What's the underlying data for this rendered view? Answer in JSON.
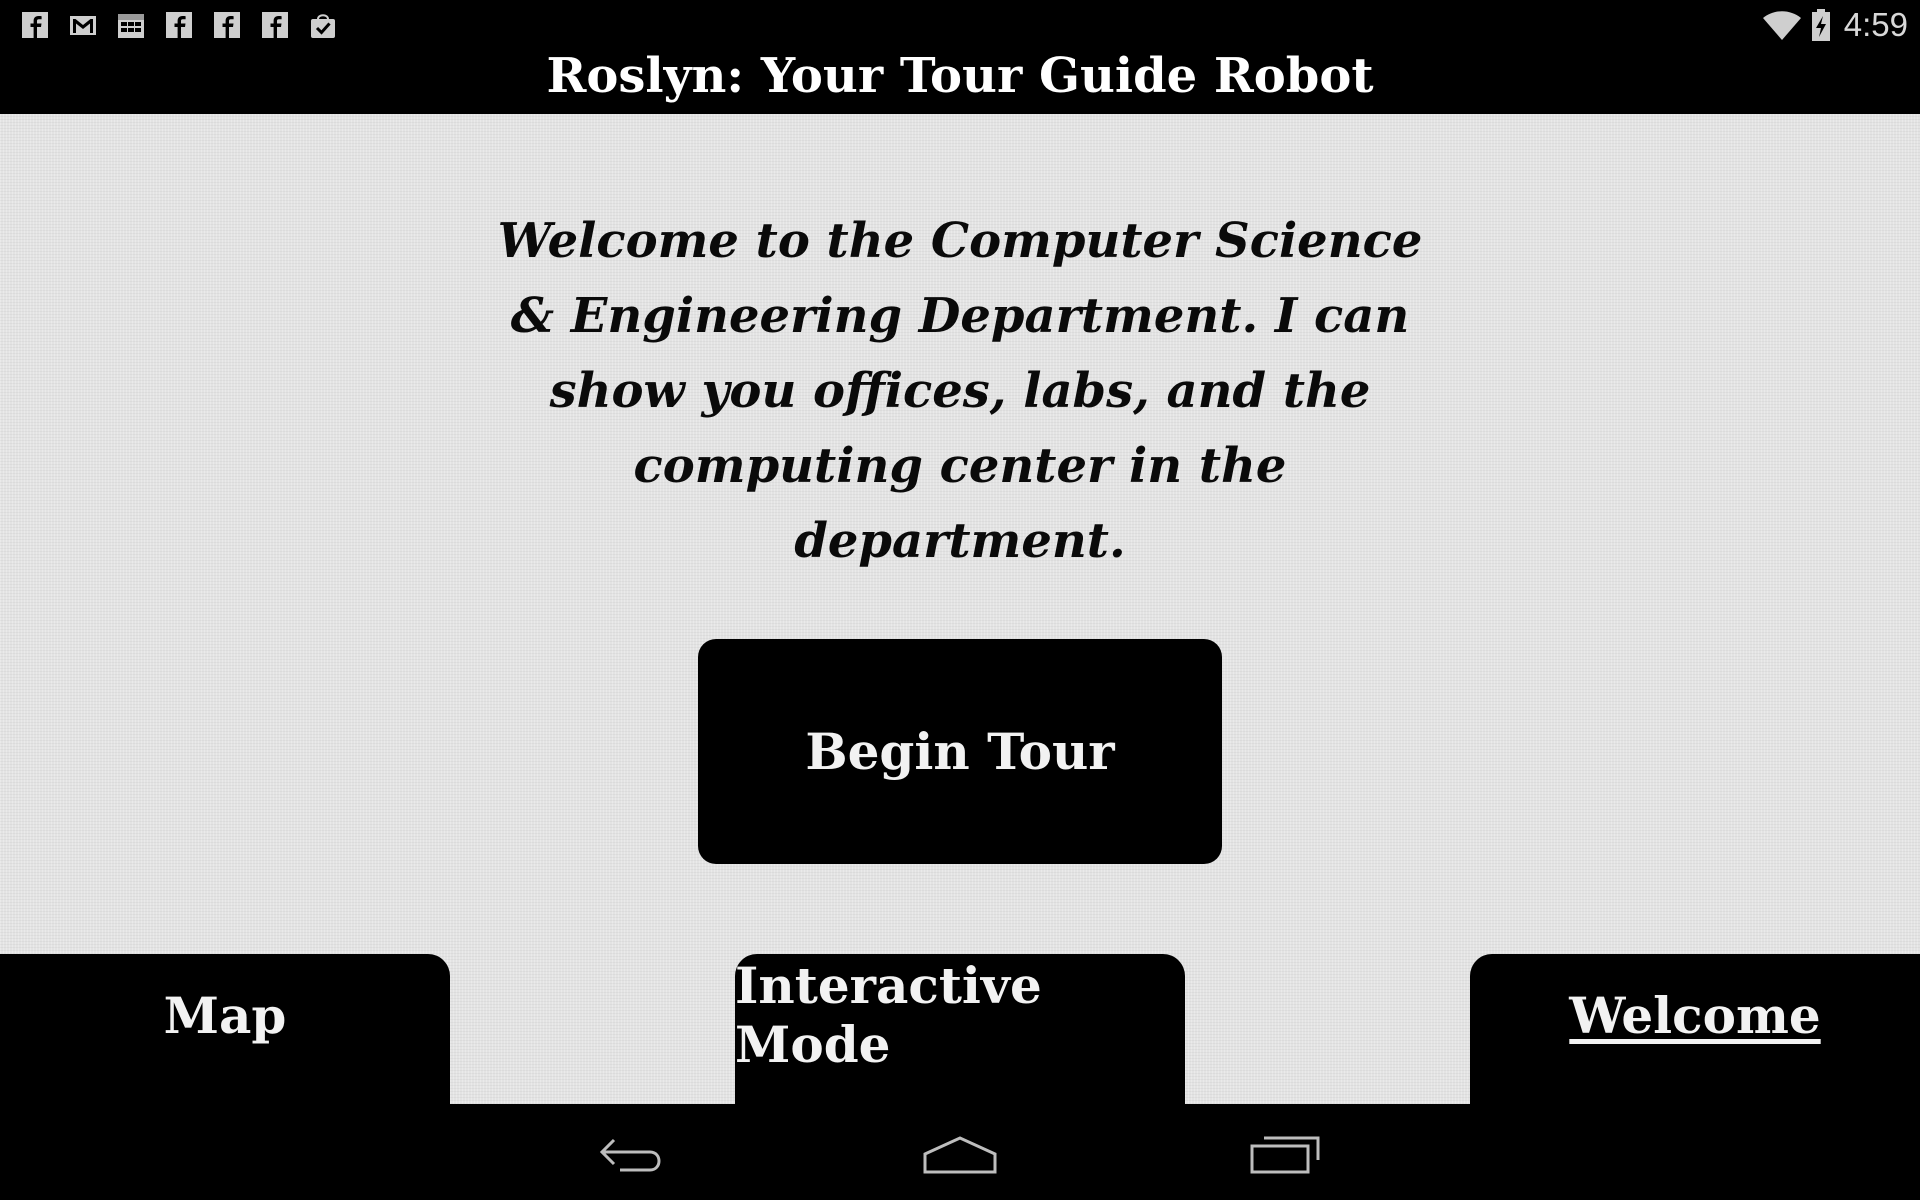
{
  "status_bar": {
    "notifications": [
      "facebook-icon",
      "gmail-icon",
      "calendar-icon",
      "facebook-icon",
      "facebook-icon",
      "facebook-icon",
      "play-store-icon"
    ],
    "clock": "4:59",
    "system_icons": [
      "wifi-icon",
      "battery-charging-icon"
    ]
  },
  "app": {
    "title": "Roslyn: Your Tour Guide Robot"
  },
  "main": {
    "welcome_text": "Welcome to the Computer Science & Engineering Department. I can show you offices, labs, and the computing center in the department.",
    "begin_tour_label": "Begin Tour"
  },
  "tabs": [
    {
      "label": "Map",
      "selected": false
    },
    {
      "label": "Interactive Mode",
      "selected": false
    },
    {
      "label": "Welcome",
      "selected": true
    }
  ],
  "navigation": [
    "back-icon",
    "home-icon",
    "recent-apps-icon"
  ],
  "colors": {
    "bar_background": "#000000",
    "content_background": "#e3e3e3",
    "text_light": "#f2f2f2",
    "text_dark": "#0a0a0a"
  }
}
